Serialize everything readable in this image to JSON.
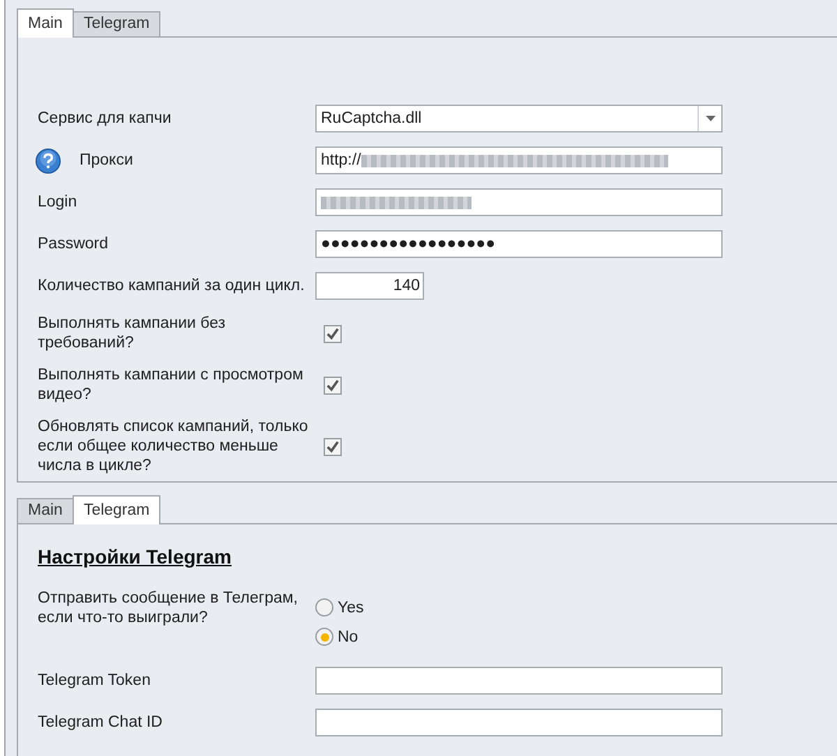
{
  "panels": [
    {
      "tabs": [
        {
          "label": "Main",
          "selected": true
        },
        {
          "label": "Telegram",
          "selected": false
        }
      ],
      "rows": [
        {
          "kind": "select",
          "label": "Сервис для капчи",
          "value": "RuCaptcha.dll"
        },
        {
          "kind": "help_field",
          "label": "Прокси",
          "value": "http://",
          "blurred": true
        },
        {
          "kind": "field",
          "label": "Login",
          "blurred": true
        },
        {
          "kind": "field",
          "label": "Password",
          "value": "●●●●●●●●●●●●●●●●●●",
          "blurred": false
        },
        {
          "kind": "number",
          "label": "Количество кампаний за один цикл.",
          "value": "140"
        },
        {
          "kind": "checkbox",
          "label": "Выполнять кампании  без требований?",
          "checked": true
        },
        {
          "kind": "checkbox",
          "label": "Выполнять кампании с просмотром видео?",
          "checked": true
        },
        {
          "kind": "checkbox",
          "label": "Обновлять список кампаний, только если общее количество меньше числа в цикле?",
          "checked": true
        }
      ]
    },
    {
      "tabs": [
        {
          "label": "Main",
          "selected": false
        },
        {
          "label": "Telegram",
          "selected": true
        }
      ],
      "rows": [
        {
          "kind": "heading",
          "label": "Настройки Telegram"
        },
        {
          "kind": "radio",
          "label": "Отправить сообщение в Телеграм, если что-то выиграли?",
          "options": [
            {
              "label": "Yes",
              "selected": false
            },
            {
              "label": "No",
              "selected": true
            }
          ]
        },
        {
          "kind": "field",
          "label": "Telegram Token",
          "blurred": false
        },
        {
          "kind": "field",
          "label": "Telegram Chat ID",
          "blurred": false
        }
      ]
    }
  ]
}
